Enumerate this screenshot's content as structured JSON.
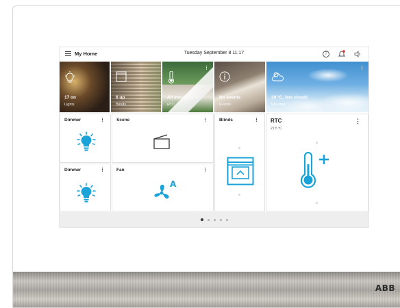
{
  "header": {
    "title": "My Home",
    "datetime": "Tuesday September 8  11:17"
  },
  "tiles": [
    {
      "value": "17 on",
      "label": "Lights",
      "icon": "lightbulb-icon"
    },
    {
      "value": "6 up",
      "label": "Blinds",
      "icon": "blinds-icon"
    },
    {
      "value": "All eco",
      "label": "RTC",
      "icon": "thermometer-icon"
    },
    {
      "value": "No events",
      "label": "Events",
      "icon": "info-icon"
    },
    {
      "value": "19 °C, few clouds",
      "label": "Weather",
      "icon": "cloud-sun-icon"
    }
  ],
  "cards": {
    "dimmer1": {
      "title": "Dimmer",
      "icon": "lightbulb-icon"
    },
    "scene": {
      "title": "Scene",
      "icon": "scene-icon"
    },
    "blinds": {
      "title": "Blinds",
      "icon": "blinds-icon"
    },
    "rtc": {
      "title": "RTC",
      "temperature": "21.5 °C",
      "icon": "thermometer-plus-icon"
    },
    "dimmer2": {
      "title": "Dimmer",
      "icon": "lightbulb-icon"
    },
    "fan": {
      "title": "Fan",
      "icon": "fan-auto-icon",
      "mode": "A"
    }
  },
  "pager": {
    "pages": 5,
    "active": 1
  },
  "brand": "ABB",
  "colors": {
    "accent": "#1aa3d9",
    "pager_bg": "#eeeeee"
  }
}
